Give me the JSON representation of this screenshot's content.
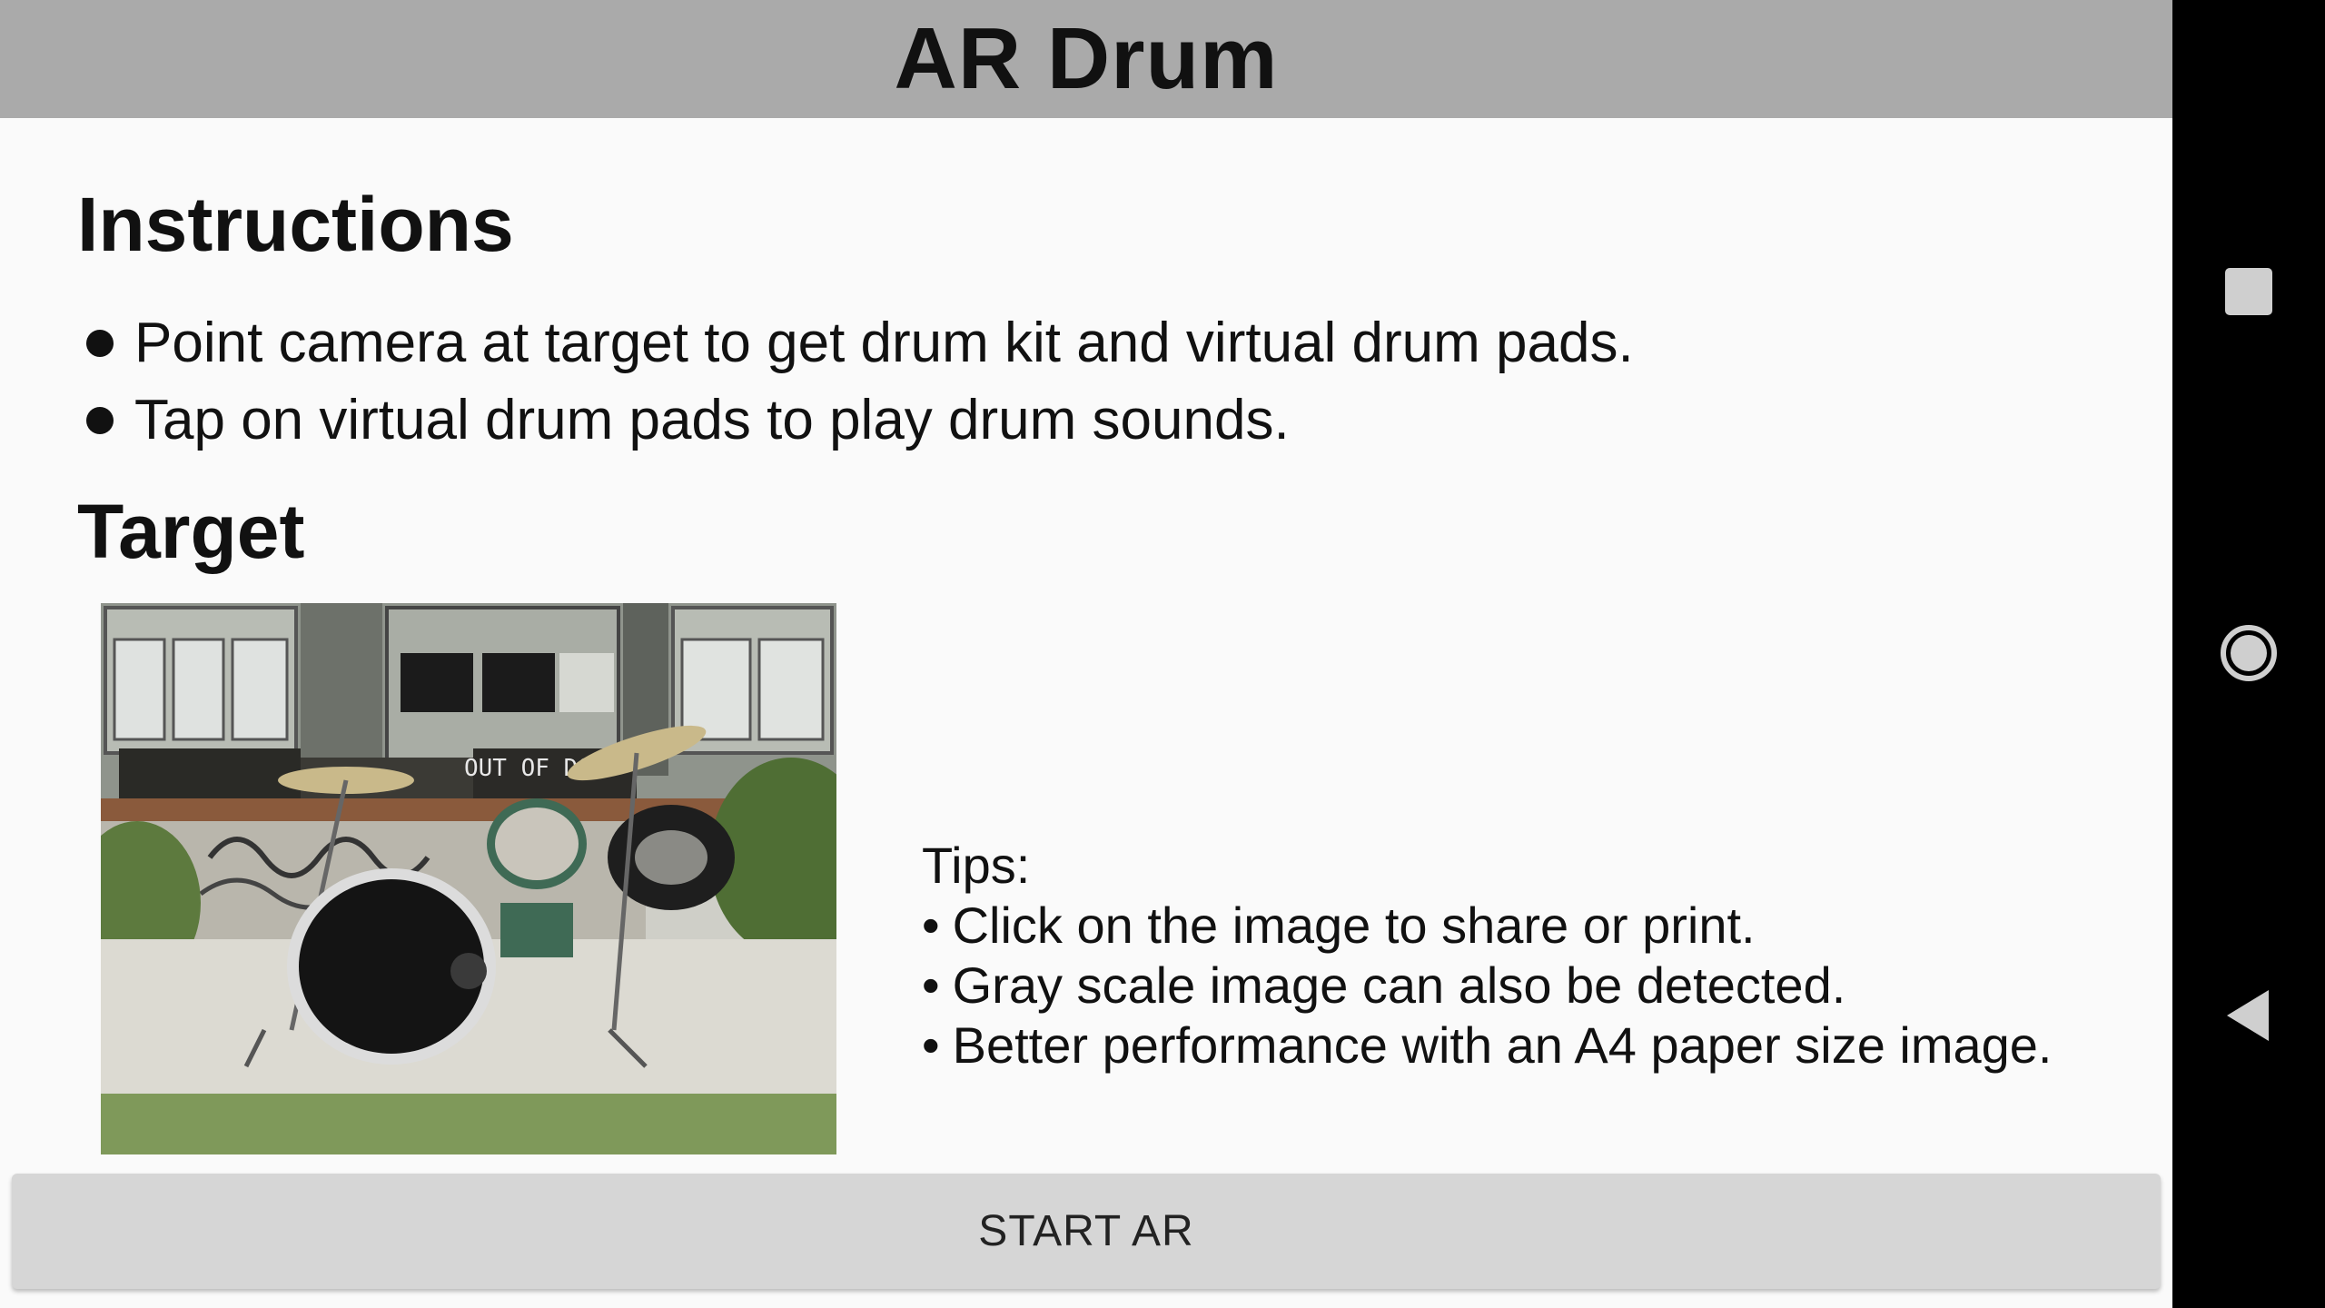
{
  "app": {
    "title": "AR Drum"
  },
  "instructions": {
    "heading": "Instructions",
    "items": [
      "Point camera at target to get drum kit and virtual drum pads.",
      "Tap on virtual drum pads to play drum sounds."
    ]
  },
  "target": {
    "heading": "Target",
    "image_sign_text": "OUT OF DO",
    "tips": {
      "heading": "Tips:",
      "bullet": "•",
      "items": [
        "Click on the image to share or print.",
        "Gray scale image can also be detected.",
        "Better performance with an A4 paper size image."
      ]
    }
  },
  "start_button": {
    "label": "START AR"
  },
  "navigation_bar": {
    "buttons": [
      {
        "icon": "recents-square-icon"
      },
      {
        "icon": "home-circle-icon"
      },
      {
        "icon": "back-triangle-icon"
      }
    ]
  },
  "colors": {
    "title_bar": "#aaaaaa",
    "content_background": "#fafafa",
    "button_background": "#d6d6d6",
    "nav_background": "#000000",
    "nav_icon": "#cfcfcf"
  }
}
